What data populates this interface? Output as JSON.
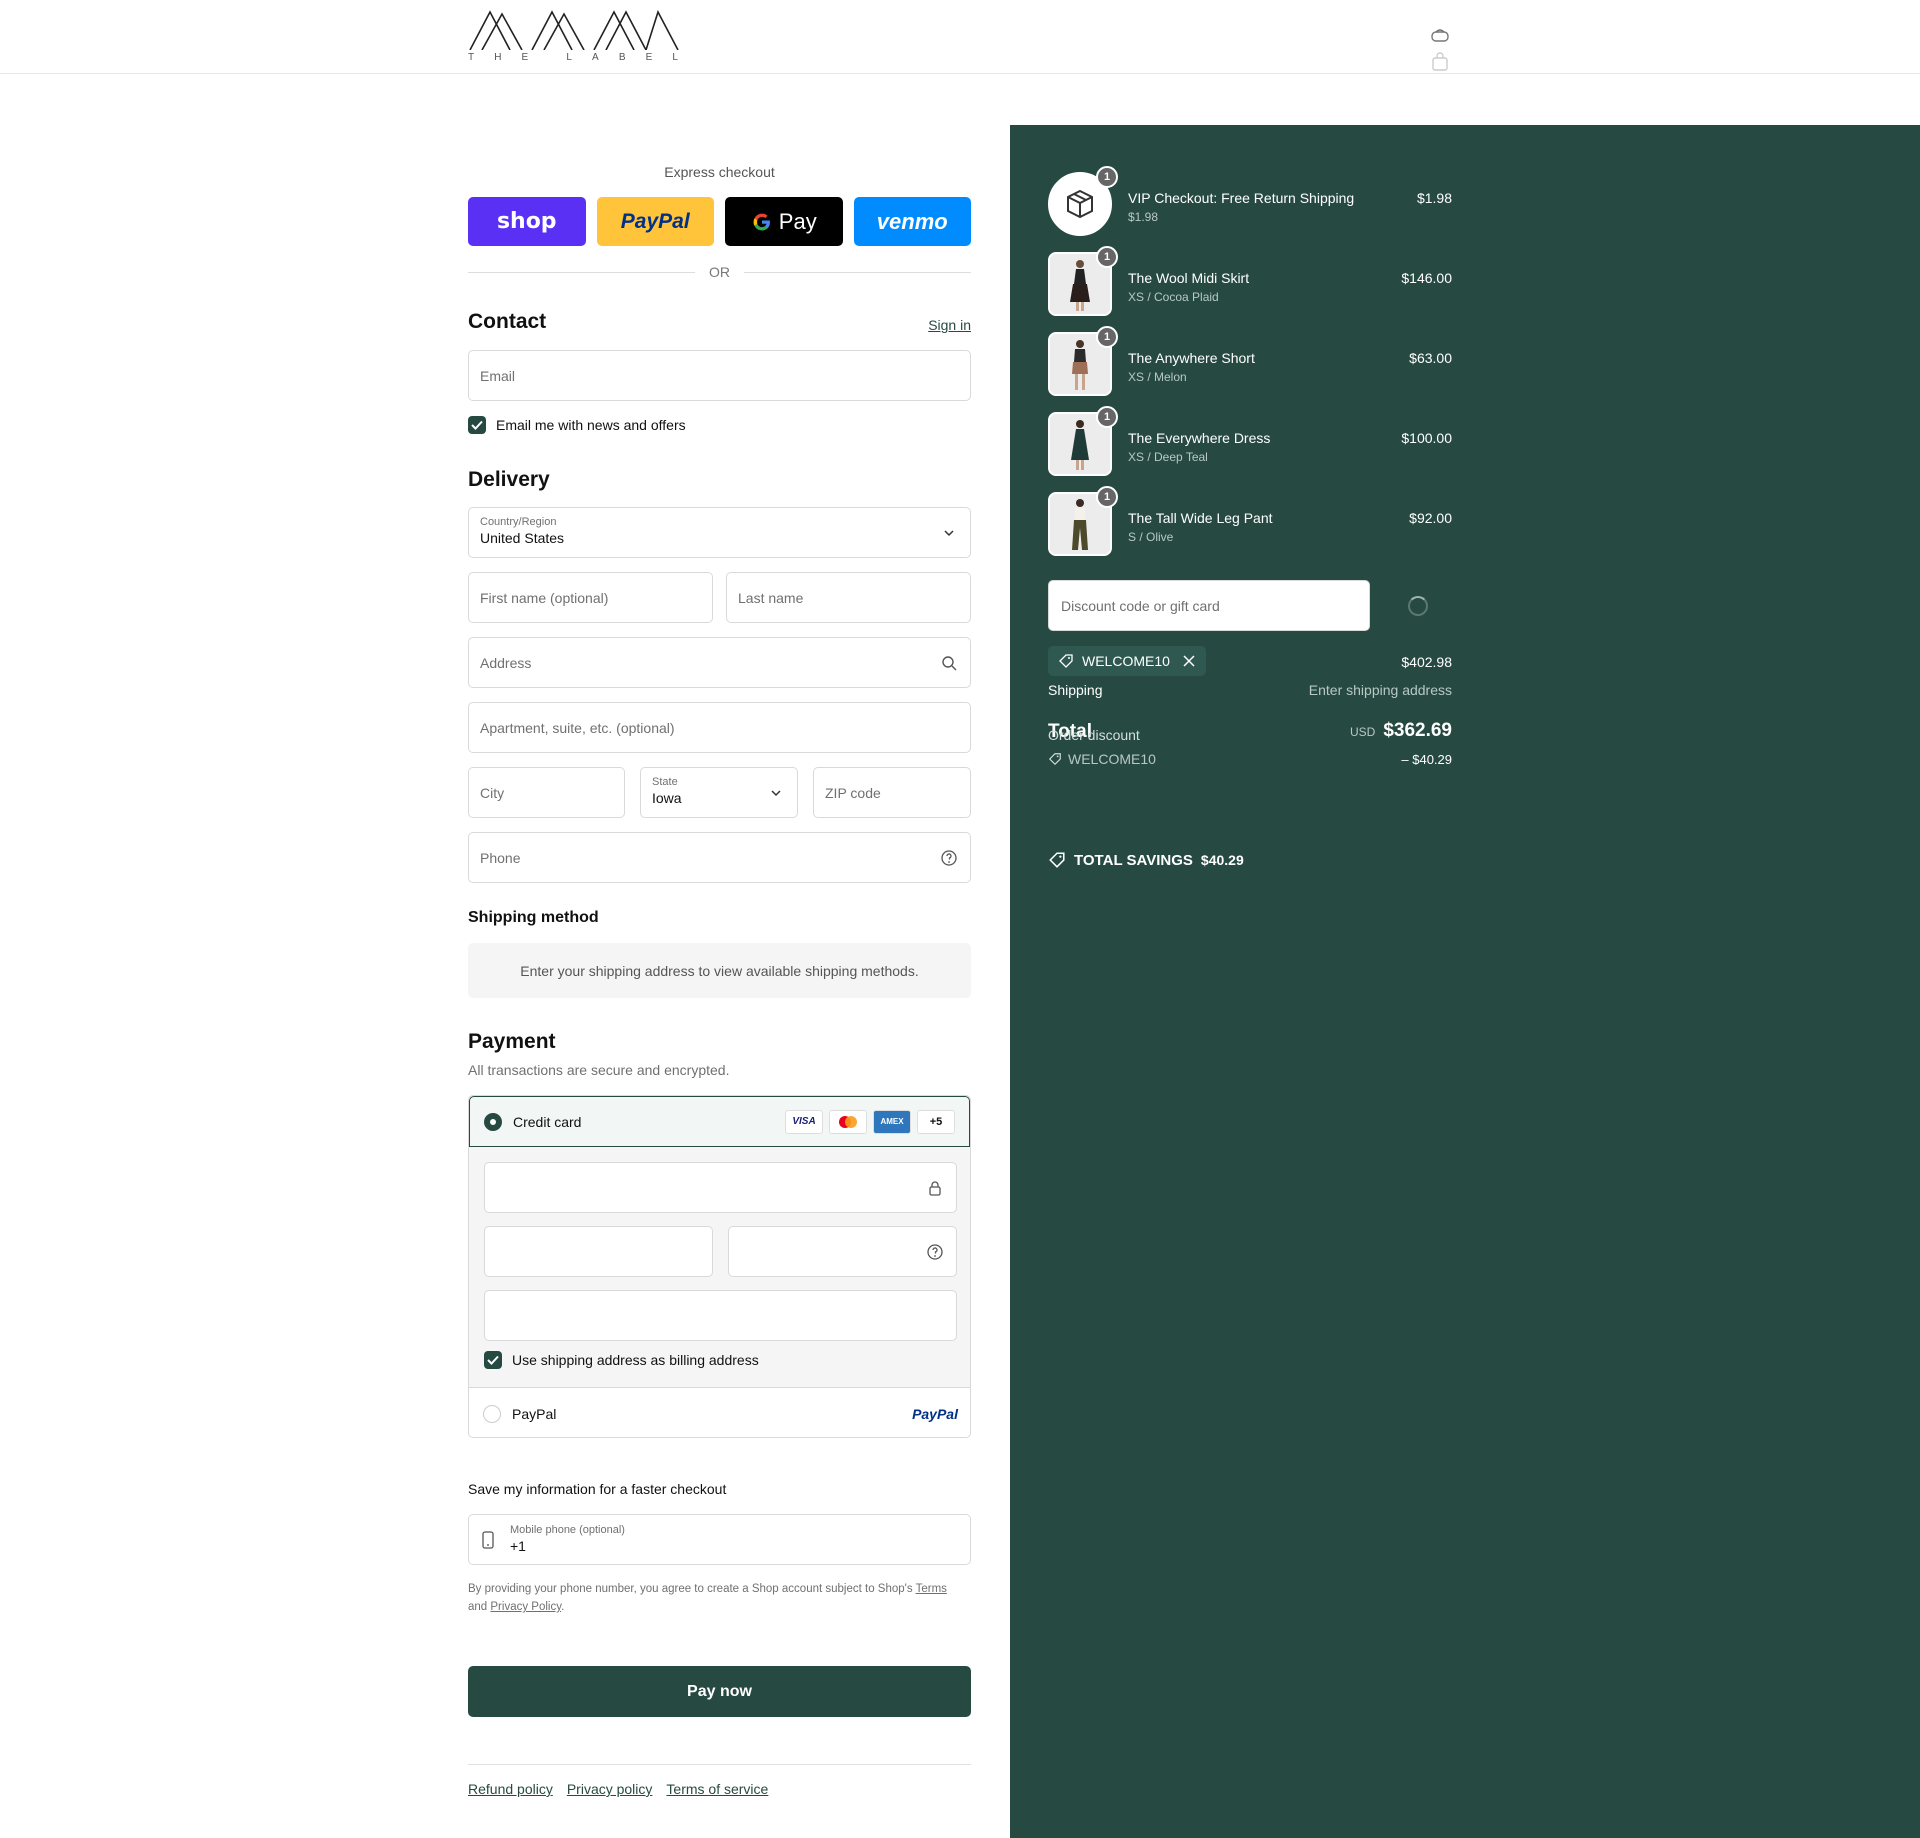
{
  "brand": {
    "logo_letters": [
      "T",
      "H",
      "E",
      "L",
      "A",
      "B",
      "E",
      "L"
    ]
  },
  "express": {
    "title": "Express checkout",
    "buttons": [
      "shop",
      "PayPal",
      "Pay",
      "venmo"
    ],
    "or": "OR"
  },
  "contact": {
    "heading": "Contact",
    "sign_in": "Sign in",
    "email_placeholder": "Email",
    "newsletter_label": "Email me with news and offers",
    "newsletter_checked": true
  },
  "delivery": {
    "heading": "Delivery",
    "country_label": "Country/Region",
    "country_value": "United States",
    "first_name": "First name (optional)",
    "last_name": "Last name",
    "address": "Address",
    "apartment": "Apartment, suite, etc. (optional)",
    "city": "City",
    "state_label": "State",
    "state_value": "Iowa",
    "zip": "ZIP code",
    "phone": "Phone"
  },
  "shipping_method": {
    "heading": "Shipping method",
    "notice": "Enter your shipping address to view available shipping methods."
  },
  "payment": {
    "heading": "Payment",
    "subtitle": "All transactions are secure and encrypted.",
    "credit_card": "Credit card",
    "card_brands": [
      "VISA",
      "",
      "AMEX",
      "+5"
    ],
    "billing_label": "Use shipping address as billing address",
    "paypal_label": "PayPal",
    "paypal_logo": "PayPal"
  },
  "save_info": {
    "title": "Save my information for a faster checkout",
    "mobile_label": "Mobile phone (optional)",
    "mobile_value": "+1",
    "disclaimer_1": "By providing your phone number, you agree to create a Shop account subject to Shop's",
    "terms": "Terms",
    "and": "and",
    "privacy": "Privacy Policy",
    "period": "."
  },
  "pay_now": "Pay now",
  "footer": {
    "links": [
      "Refund policy",
      "Privacy policy",
      "Terms of service"
    ]
  },
  "summary": {
    "items": [
      {
        "name": "VIP Checkout: Free Return Shipping",
        "variant": "$1.98",
        "price": "$1.98",
        "qty": "1"
      },
      {
        "name": "The Wool Midi Skirt",
        "variant": "XS / Cocoa Plaid",
        "price": "$146.00",
        "qty": "1"
      },
      {
        "name": "The Anywhere Short",
        "variant": "XS / Melon",
        "price": "$63.00",
        "qty": "1"
      },
      {
        "name": "The Everywhere Dress",
        "variant": "XS / Deep Teal",
        "price": "$100.00",
        "qty": "1"
      },
      {
        "name": "The Tall Wide Leg Pant",
        "variant": "S / Olive",
        "price": "$92.00",
        "qty": "1"
      }
    ],
    "discount_placeholder": "Discount code or gift card",
    "applied_code": "WELCOME10",
    "subtotal_value": "$402.98",
    "shipping_label": "Shipping",
    "shipping_value": "Enter shipping address",
    "total_label": "Total",
    "currency": "USD",
    "total_value": "$362.69",
    "order_discount_label": "Order discount",
    "discount_code": "WELCOME10",
    "discount_value": "– $40.29",
    "savings_label": "TOTAL SAVINGS",
    "savings_value": "$40.29"
  },
  "colors": {
    "accent": "#264a42",
    "shop": "#5a31f4",
    "paypal": "#ffc439",
    "venmo": "#008cff"
  }
}
